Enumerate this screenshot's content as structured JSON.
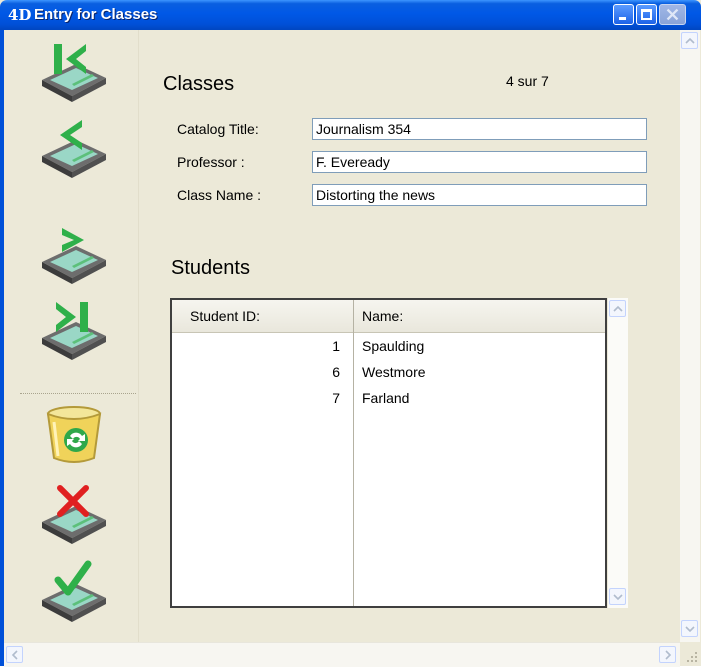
{
  "window": {
    "title": "Entry for Classes",
    "app_logo": "4D"
  },
  "sidebar": {
    "buttons": [
      {
        "name": "first-record-button",
        "icon": "first-record-icon"
      },
      {
        "name": "previous-record-button",
        "icon": "previous-record-icon"
      },
      {
        "name": "next-record-button",
        "icon": "next-record-icon"
      },
      {
        "name": "last-record-button",
        "icon": "last-record-icon"
      },
      {
        "name": "delete-record-button",
        "icon": "trash-recycle-icon"
      },
      {
        "name": "cancel-button",
        "icon": "cancel-x-icon"
      },
      {
        "name": "accept-button",
        "icon": "accept-check-icon"
      }
    ]
  },
  "form": {
    "section_title": "Classes",
    "record_counter": "4 sur 7",
    "fields": {
      "catalog_title": {
        "label": "Catalog Title:",
        "value": "Journalism 354"
      },
      "professor": {
        "label": "Professor :",
        "value": "F. Eveready"
      },
      "class_name": {
        "label": "Class Name :",
        "value": "Distorting the news"
      }
    }
  },
  "students": {
    "section_title": "Students",
    "columns": [
      "Student ID:",
      "Name:"
    ],
    "rows": [
      {
        "id": "1",
        "name": "Spaulding"
      },
      {
        "id": "6",
        "name": "Westmore"
      },
      {
        "id": "7",
        "name": "Farland"
      }
    ]
  },
  "colors": {
    "titlebar": "#0058e6",
    "window_bg": "#ece9d8",
    "field_border": "#7f9db9",
    "nav_arrow_green": "#2fb04a",
    "cancel_red": "#e02020"
  }
}
